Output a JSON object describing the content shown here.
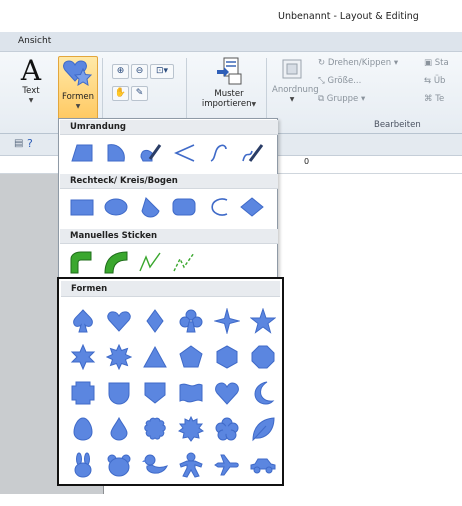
{
  "window": {
    "title": "Unbenannt - Layout & Editing"
  },
  "menu": {
    "tab": "Ansicht"
  },
  "ribbon": {
    "text_label": "Text",
    "formen_label": "Formen",
    "muster_label_1": "Muster",
    "muster_label_2": "importieren",
    "anordnung_label": "Anordnung",
    "drehen_label": "Drehen/Kippen",
    "groesse_label": "Größe...",
    "gruppe_label": "Gruppe",
    "bearbeiten_label": "Bearbeiten",
    "clip_st": "Sta",
    "clip_ub": "Üb",
    "clip_te": "Te"
  },
  "ruler": {
    "zero": "0"
  },
  "dropdown": {
    "sections": [
      {
        "title": "Umrandung"
      },
      {
        "title": "Rechteck/ Kreis/Bogen"
      },
      {
        "title": "Manuelles Sticken"
      },
      {
        "title": "Formen"
      }
    ]
  },
  "colors": {
    "shape_fill": "#5b86e0",
    "shape_stroke": "#3f6ac8",
    "green": "#3aa72e",
    "accent": "#ffc860"
  },
  "icons": [
    "text-icon",
    "formen-icon",
    "zoom-in-icon",
    "zoom-out-icon",
    "zoom-fit-icon",
    "hand-icon",
    "measure-icon",
    "muster-import-icon",
    "anordnung-icon",
    "rotate-icon",
    "resize-icon",
    "group-icon",
    "help-icon"
  ]
}
